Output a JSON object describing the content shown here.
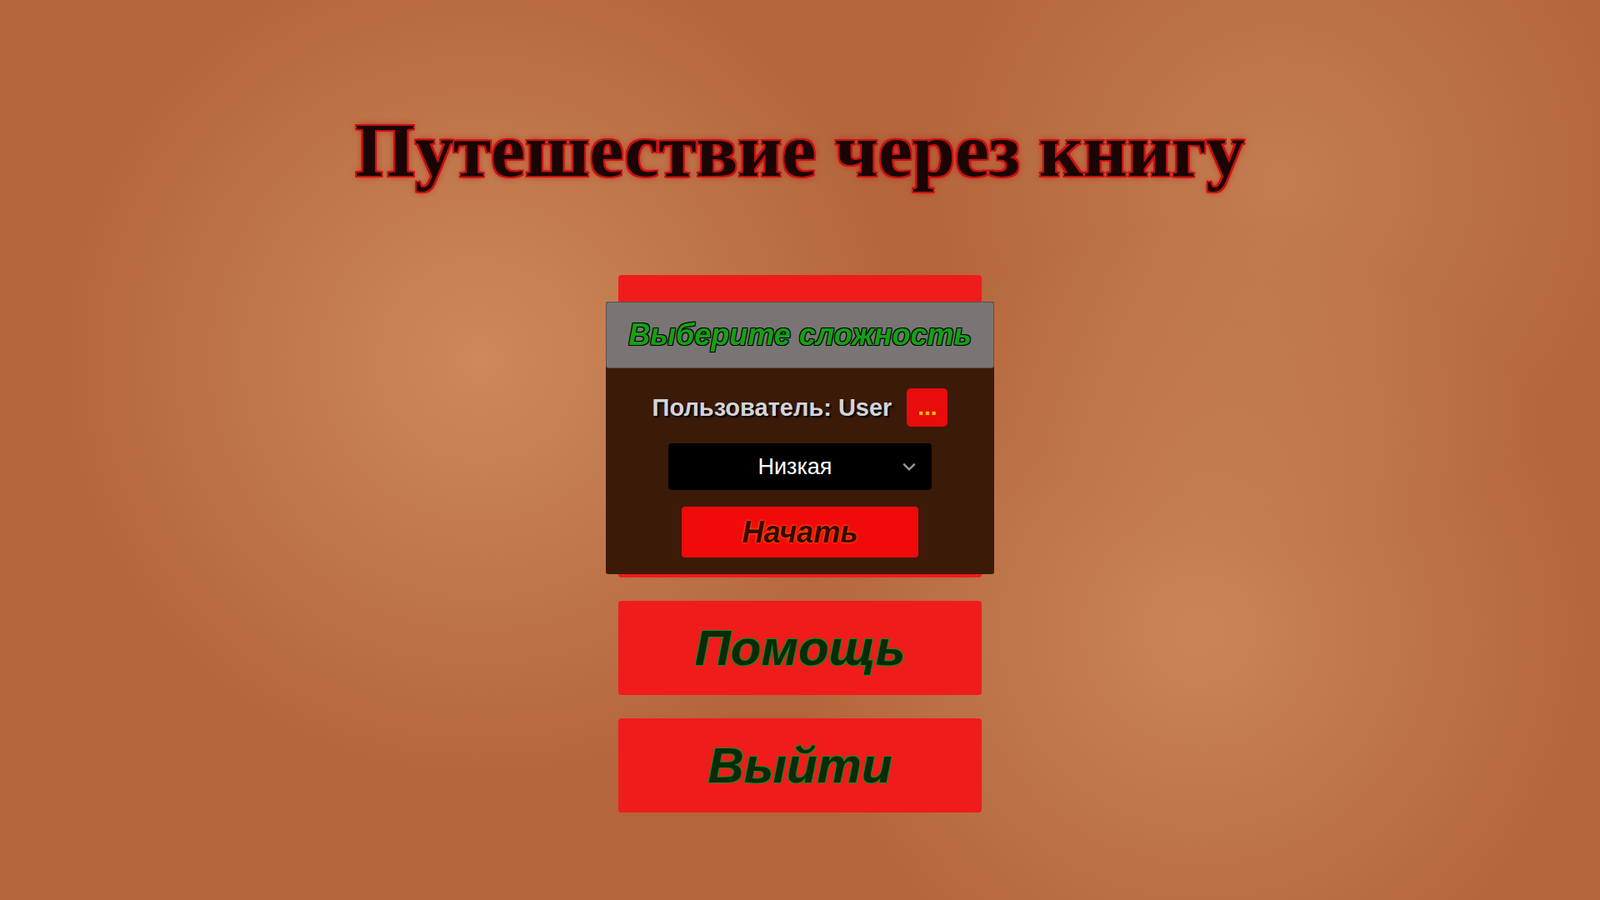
{
  "title": "Путешествие через книгу",
  "dialog": {
    "title": "Выберите сложность",
    "user_label": "Пользователь: User",
    "user_button": "...",
    "difficulty": {
      "value": "Низкая",
      "expanded": false
    },
    "start_button": "Начать"
  },
  "menu": [
    {
      "label": "Помощь"
    },
    {
      "label": "Выйти"
    }
  ]
}
